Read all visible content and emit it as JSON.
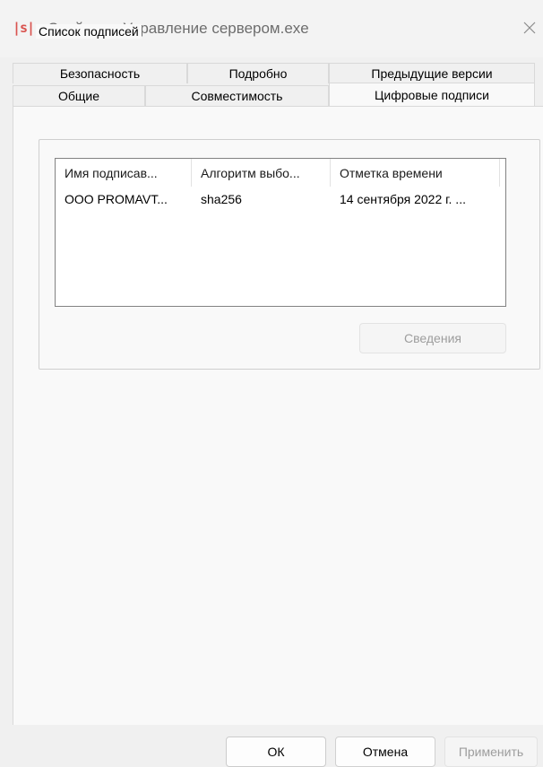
{
  "window": {
    "icon": "|s|",
    "title": "Свойства: Управление сервером.exe"
  },
  "tabs": {
    "row1": [
      "Безопасность",
      "Подробно",
      "Предыдущие версии"
    ],
    "row2": [
      "Общие",
      "Совместимость",
      "Цифровые подписи"
    ],
    "active": "Цифровые подписи"
  },
  "signatures": {
    "group_label": "Список подписей",
    "columns": [
      "Имя подписав...",
      "Алгоритм выбо...",
      "Отметка времени"
    ],
    "rows": [
      [
        "ООО PROMAVT...",
        "sha256",
        "14 сентября 2022 г. ..."
      ]
    ],
    "details_button": "Сведения"
  },
  "footer": {
    "ok": "ОК",
    "cancel": "Отмена",
    "apply": "Применить"
  },
  "colors": {
    "app_icon": "#d9534f"
  }
}
